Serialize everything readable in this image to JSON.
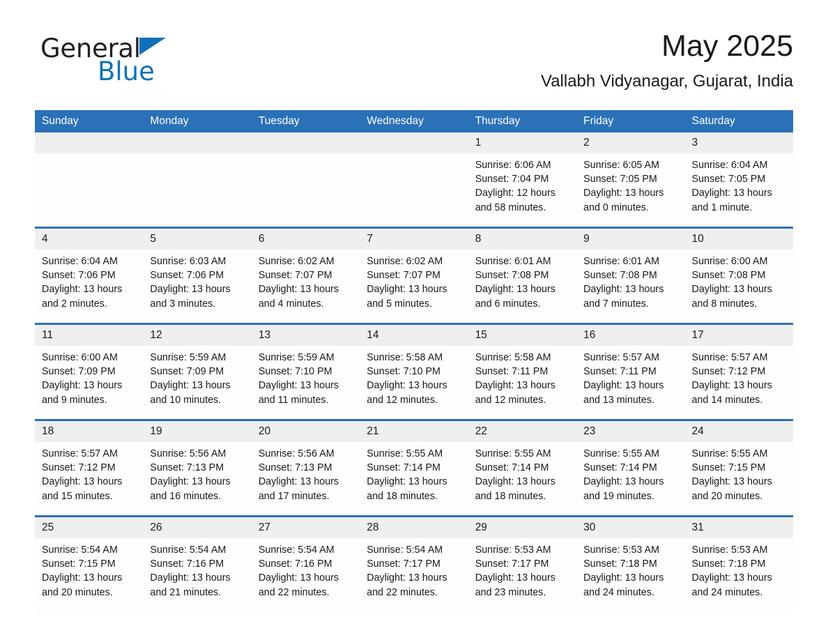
{
  "brand": {
    "name_part1": "General",
    "name_part2": "Blue",
    "accent_color": "#1071b8"
  },
  "header": {
    "title": "May 2025",
    "subtitle": "Vallabh Vidyanagar, Gujarat, India"
  },
  "theme": {
    "header_blue": "#2b71b8",
    "daynum_gray": "#efefef",
    "cell_white": "#fdfdfd"
  },
  "calendar": {
    "weekday_headers": [
      "Sunday",
      "Monday",
      "Tuesday",
      "Wednesday",
      "Thursday",
      "Friday",
      "Saturday"
    ],
    "weeks": [
      [
        {
          "day": "",
          "sunrise": "",
          "sunset": "",
          "daylight": "",
          "empty": true
        },
        {
          "day": "",
          "sunrise": "",
          "sunset": "",
          "daylight": "",
          "empty": true
        },
        {
          "day": "",
          "sunrise": "",
          "sunset": "",
          "daylight": "",
          "empty": true
        },
        {
          "day": "",
          "sunrise": "",
          "sunset": "",
          "daylight": "",
          "empty": true
        },
        {
          "day": "1",
          "sunrise": "Sunrise: 6:06 AM",
          "sunset": "Sunset: 7:04 PM",
          "daylight": "Daylight: 12 hours and 58 minutes.",
          "empty": false
        },
        {
          "day": "2",
          "sunrise": "Sunrise: 6:05 AM",
          "sunset": "Sunset: 7:05 PM",
          "daylight": "Daylight: 13 hours and 0 minutes.",
          "empty": false
        },
        {
          "day": "3",
          "sunrise": "Sunrise: 6:04 AM",
          "sunset": "Sunset: 7:05 PM",
          "daylight": "Daylight: 13 hours and 1 minute.",
          "empty": false
        }
      ],
      [
        {
          "day": "4",
          "sunrise": "Sunrise: 6:04 AM",
          "sunset": "Sunset: 7:06 PM",
          "daylight": "Daylight: 13 hours and 2 minutes.",
          "empty": false
        },
        {
          "day": "5",
          "sunrise": "Sunrise: 6:03 AM",
          "sunset": "Sunset: 7:06 PM",
          "daylight": "Daylight: 13 hours and 3 minutes.",
          "empty": false
        },
        {
          "day": "6",
          "sunrise": "Sunrise: 6:02 AM",
          "sunset": "Sunset: 7:07 PM",
          "daylight": "Daylight: 13 hours and 4 minutes.",
          "empty": false
        },
        {
          "day": "7",
          "sunrise": "Sunrise: 6:02 AM",
          "sunset": "Sunset: 7:07 PM",
          "daylight": "Daylight: 13 hours and 5 minutes.",
          "empty": false
        },
        {
          "day": "8",
          "sunrise": "Sunrise: 6:01 AM",
          "sunset": "Sunset: 7:08 PM",
          "daylight": "Daylight: 13 hours and 6 minutes.",
          "empty": false
        },
        {
          "day": "9",
          "sunrise": "Sunrise: 6:01 AM",
          "sunset": "Sunset: 7:08 PM",
          "daylight": "Daylight: 13 hours and 7 minutes.",
          "empty": false
        },
        {
          "day": "10",
          "sunrise": "Sunrise: 6:00 AM",
          "sunset": "Sunset: 7:08 PM",
          "daylight": "Daylight: 13 hours and 8 minutes.",
          "empty": false
        }
      ],
      [
        {
          "day": "11",
          "sunrise": "Sunrise: 6:00 AM",
          "sunset": "Sunset: 7:09 PM",
          "daylight": "Daylight: 13 hours and 9 minutes.",
          "empty": false
        },
        {
          "day": "12",
          "sunrise": "Sunrise: 5:59 AM",
          "sunset": "Sunset: 7:09 PM",
          "daylight": "Daylight: 13 hours and 10 minutes.",
          "empty": false
        },
        {
          "day": "13",
          "sunrise": "Sunrise: 5:59 AM",
          "sunset": "Sunset: 7:10 PM",
          "daylight": "Daylight: 13 hours and 11 minutes.",
          "empty": false
        },
        {
          "day": "14",
          "sunrise": "Sunrise: 5:58 AM",
          "sunset": "Sunset: 7:10 PM",
          "daylight": "Daylight: 13 hours and 12 minutes.",
          "empty": false
        },
        {
          "day": "15",
          "sunrise": "Sunrise: 5:58 AM",
          "sunset": "Sunset: 7:11 PM",
          "daylight": "Daylight: 13 hours and 12 minutes.",
          "empty": false
        },
        {
          "day": "16",
          "sunrise": "Sunrise: 5:57 AM",
          "sunset": "Sunset: 7:11 PM",
          "daylight": "Daylight: 13 hours and 13 minutes.",
          "empty": false
        },
        {
          "day": "17",
          "sunrise": "Sunrise: 5:57 AM",
          "sunset": "Sunset: 7:12 PM",
          "daylight": "Daylight: 13 hours and 14 minutes.",
          "empty": false
        }
      ],
      [
        {
          "day": "18",
          "sunrise": "Sunrise: 5:57 AM",
          "sunset": "Sunset: 7:12 PM",
          "daylight": "Daylight: 13 hours and 15 minutes.",
          "empty": false
        },
        {
          "day": "19",
          "sunrise": "Sunrise: 5:56 AM",
          "sunset": "Sunset: 7:13 PM",
          "daylight": "Daylight: 13 hours and 16 minutes.",
          "empty": false
        },
        {
          "day": "20",
          "sunrise": "Sunrise: 5:56 AM",
          "sunset": "Sunset: 7:13 PM",
          "daylight": "Daylight: 13 hours and 17 minutes.",
          "empty": false
        },
        {
          "day": "21",
          "sunrise": "Sunrise: 5:55 AM",
          "sunset": "Sunset: 7:14 PM",
          "daylight": "Daylight: 13 hours and 18 minutes.",
          "empty": false
        },
        {
          "day": "22",
          "sunrise": "Sunrise: 5:55 AM",
          "sunset": "Sunset: 7:14 PM",
          "daylight": "Daylight: 13 hours and 18 minutes.",
          "empty": false
        },
        {
          "day": "23",
          "sunrise": "Sunrise: 5:55 AM",
          "sunset": "Sunset: 7:14 PM",
          "daylight": "Daylight: 13 hours and 19 minutes.",
          "empty": false
        },
        {
          "day": "24",
          "sunrise": "Sunrise: 5:55 AM",
          "sunset": "Sunset: 7:15 PM",
          "daylight": "Daylight: 13 hours and 20 minutes.",
          "empty": false
        }
      ],
      [
        {
          "day": "25",
          "sunrise": "Sunrise: 5:54 AM",
          "sunset": "Sunset: 7:15 PM",
          "daylight": "Daylight: 13 hours and 20 minutes.",
          "empty": false
        },
        {
          "day": "26",
          "sunrise": "Sunrise: 5:54 AM",
          "sunset": "Sunset: 7:16 PM",
          "daylight": "Daylight: 13 hours and 21 minutes.",
          "empty": false
        },
        {
          "day": "27",
          "sunrise": "Sunrise: 5:54 AM",
          "sunset": "Sunset: 7:16 PM",
          "daylight": "Daylight: 13 hours and 22 minutes.",
          "empty": false
        },
        {
          "day": "28",
          "sunrise": "Sunrise: 5:54 AM",
          "sunset": "Sunset: 7:17 PM",
          "daylight": "Daylight: 13 hours and 22 minutes.",
          "empty": false
        },
        {
          "day": "29",
          "sunrise": "Sunrise: 5:53 AM",
          "sunset": "Sunset: 7:17 PM",
          "daylight": "Daylight: 13 hours and 23 minutes.",
          "empty": false
        },
        {
          "day": "30",
          "sunrise": "Sunrise: 5:53 AM",
          "sunset": "Sunset: 7:18 PM",
          "daylight": "Daylight: 13 hours and 24 minutes.",
          "empty": false
        },
        {
          "day": "31",
          "sunrise": "Sunrise: 5:53 AM",
          "sunset": "Sunset: 7:18 PM",
          "daylight": "Daylight: 13 hours and 24 minutes.",
          "empty": false
        }
      ]
    ]
  }
}
